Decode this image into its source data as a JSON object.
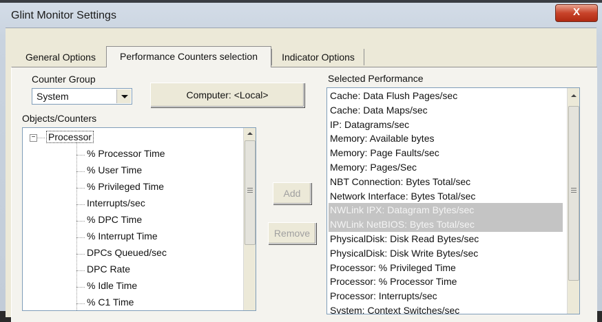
{
  "window": {
    "title": "Glint Monitor Settings",
    "close_glyph": "X"
  },
  "tabs": [
    {
      "label": "General Options",
      "active": false
    },
    {
      "label": "Performance Counters selection",
      "active": true
    },
    {
      "label": "Indicator Options",
      "active": false
    }
  ],
  "counter_group": {
    "label": "Counter Group",
    "value": "System"
  },
  "computer_button": "Computer: <Local>",
  "objects": {
    "label": "Objects/Counters",
    "root": "Processor",
    "expander": "−",
    "children": [
      "% Processor Time",
      "% User Time",
      "% Privileged Time",
      "Interrupts/sec",
      "% DPC Time",
      "% Interrupt Time",
      "DPCs Queued/sec",
      "DPC Rate",
      "% Idle Time",
      "% C1 Time"
    ]
  },
  "actions": {
    "add": "Add",
    "remove": "Remove"
  },
  "selected": {
    "label": "Selected Performance",
    "items": [
      "Cache: Data Flush Pages/sec",
      "Cache: Data Maps/sec",
      "IP: Datagrams/sec",
      "Memory: Available bytes",
      "Memory: Page Faults/sec",
      "Memory: Pages/Sec",
      "NBT Connection: Bytes Total/sec",
      "Network Interface: Bytes Total/sec",
      "NWLink IPX: Datagram Bytes/sec",
      "NWLink NetBIOS: Bytes Total/sec",
      "PhysicalDisk: Disk Read Bytes/sec",
      "PhysicalDisk: Disk Write Bytes/sec",
      "Processor: % Privileged Time",
      "Processor: % Processor Time",
      "Processor: Interrupts/sec",
      "System: Context Switches/sec"
    ],
    "selected_items": [
      "NWLink IPX: Datagram Bytes/sec",
      "NWLink NetBIOS: Bytes Total/sec"
    ]
  }
}
